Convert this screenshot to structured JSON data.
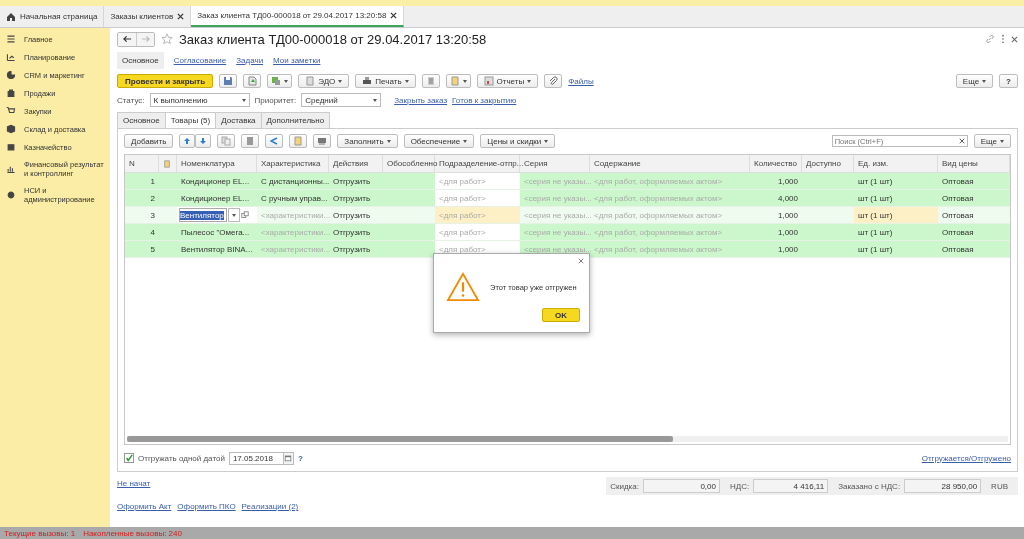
{
  "window_tabs": [
    {
      "label": "Начальная страница",
      "kind": "home",
      "selected": false
    },
    {
      "label": "Заказы клиентов",
      "kind": "closable",
      "selected": false
    },
    {
      "label": "Заказ клиента ТД00-000018 от 29.04.2017 13:20:58",
      "kind": "closable",
      "selected": true
    }
  ],
  "sidebar": {
    "items": [
      {
        "label": "Главное"
      },
      {
        "label": "Планирование"
      },
      {
        "label": "CRM и маркетинг"
      },
      {
        "label": "Продажи"
      },
      {
        "label": "Закупки"
      },
      {
        "label": "Склад и доставка"
      },
      {
        "label": "Казначейство"
      },
      {
        "label": "Финансовый результат и контроллинг"
      },
      {
        "label": "НСИ и администрирование"
      }
    ]
  },
  "document": {
    "title": "Заказ клиента ТД00-000018 от 29.04.2017 13:20:58",
    "favorite": false,
    "sections": [
      {
        "label": "Основное",
        "selected": true
      },
      {
        "label": "Согласование",
        "selected": false
      },
      {
        "label": "Задачи",
        "selected": false
      },
      {
        "label": "Мои заметки",
        "selected": false
      }
    ],
    "toolbar": {
      "primary": "Провести и закрыть",
      "edo": "ЭДО",
      "print": "Печать",
      "reports": "Отчеты",
      "files": "Файлы",
      "more": "Еще",
      "help": "?"
    },
    "status": {
      "label": "Статус:",
      "value": "К выполнению"
    },
    "priority": {
      "label": "Приоритет:",
      "value": "Средний"
    },
    "links": [
      "Закрыть заказ",
      "Готов к закрытию"
    ],
    "tabs": [
      {
        "label": "Основное",
        "selected": false
      },
      {
        "label": "Товары (5)",
        "selected": true
      },
      {
        "label": "Доставка",
        "selected": false
      },
      {
        "label": "Дополнительно",
        "selected": false
      }
    ],
    "table_toolbar": {
      "add": "Добавить",
      "fill": "Заполнить",
      "supply": "Обеспечение",
      "prices": "Цены и скидки",
      "search_placeholder": "Поиск (Ctrl+F)",
      "more": "Еще"
    },
    "table": {
      "columns": [
        "N",
        "Номенклатура",
        "Характеристика",
        "Действия",
        "Обособленно",
        "Подразделение-отпр...",
        "Серия",
        "Содержание",
        "Количество",
        "Доступно",
        "Ед. изм.",
        "Вид цены"
      ],
      "rows": [
        {
          "n": "1",
          "item": "Кондиционер EL...",
          "characteristic": {
            "text": "С дистанционны...",
            "greyed": false
          },
          "action": "Отгрузить",
          "division": "<для работ>",
          "series": "<серия не указы...",
          "content": "<для работ, оформляемых актом>",
          "quantity": "1,000",
          "unit": "шт (1 шт)",
          "price_type": "Оптовая",
          "selected": false
        },
        {
          "n": "2",
          "item": "Кондиционер EL...",
          "characteristic": {
            "text": "С ручным управ...",
            "greyed": false
          },
          "action": "Отгрузить",
          "division": "<для работ>",
          "series": "<серия не указы...",
          "content": "<для работ, оформляемых актом>",
          "quantity": "4,000",
          "unit": "шт (1 шт)",
          "price_type": "Оптовая",
          "selected": false
        },
        {
          "n": "3",
          "item": "Вентилятор",
          "characteristic": {
            "text": "<характеристики...",
            "greyed": true
          },
          "action": "Отгрузить",
          "division": "<для работ>",
          "series": "<серия не указы...",
          "content": "<для работ, оформляемых актом>",
          "quantity": "1,000",
          "unit": "шт (1 шт)",
          "price_type": "Оптовая",
          "selected": true
        },
        {
          "n": "4",
          "item": "Пылесос \"Омега...",
          "characteristic": {
            "text": "<характеристики...",
            "greyed": true
          },
          "action": "Отгрузить",
          "division": "<для работ>",
          "series": "<серия не указы...",
          "content": "<для работ, оформляемых актом>",
          "quantity": "1,000",
          "unit": "шт (1 шт)",
          "price_type": "Оптовая",
          "selected": false
        },
        {
          "n": "5",
          "item": "Вентилятор BINA...",
          "characteristic": {
            "text": "<характеристики...",
            "greyed": true
          },
          "action": "Отгрузить",
          "division": "<для работ>",
          "series": "<серия не указы...",
          "content": "<для работ, оформляемых актом>",
          "quantity": "1,000",
          "unit": "шт (1 шт)",
          "price_type": "Оптовая",
          "selected": false
        }
      ]
    },
    "ship_one_date": {
      "label": "Отгружать одной датой",
      "checked": true,
      "date": "17.05.2018",
      "help": "?"
    },
    "shipping_link": "Отгружается/Отгружено",
    "state_link": "Не начат",
    "totals": [
      {
        "label": "Скидка:",
        "value": "0,00"
      },
      {
        "label": "НДС:",
        "value": "4 416,11"
      },
      {
        "label": "Заказано с НДС:",
        "value": "28 950,00"
      }
    ],
    "currency": "RUB",
    "bottom_links": [
      "Оформить Акт",
      "Оформить ПКО",
      "Реализации (2)"
    ]
  },
  "dialog": {
    "message": "Этот товар уже отгружен",
    "ok": "OK"
  },
  "status_bar": {
    "current": "Текущие вызовы: 1",
    "accumulated": "Накопленные вызовы: 240"
  }
}
